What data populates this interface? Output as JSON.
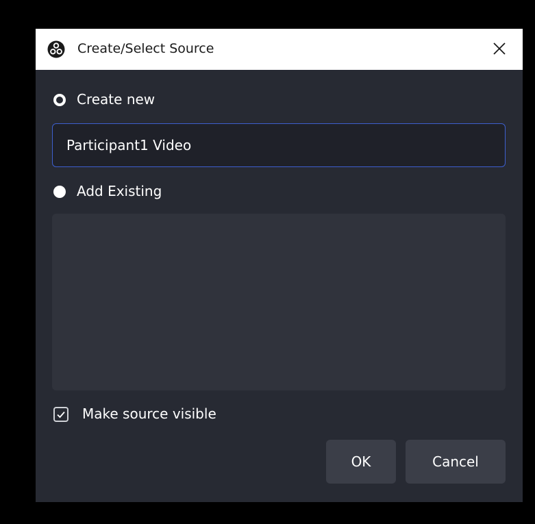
{
  "window": {
    "title": "Create/Select Source",
    "app_icon": "obs-logo-icon",
    "close_icon": "close-icon"
  },
  "options": {
    "create_new_label": "Create new",
    "name_value": "Participant1 Video",
    "add_existing_label": "Add Existing",
    "existing_sources": []
  },
  "visibility": {
    "label": "Make source visible",
    "checked": true
  },
  "buttons": {
    "ok_label": "OK",
    "cancel_label": "Cancel"
  },
  "colors": {
    "dialog_bg": "#272a33",
    "input_bg": "#1f2129",
    "input_focus_border": "#3d5fcf",
    "list_bg": "#30333c",
    "button_bg": "#3b3e48",
    "title_bar_bg": "#ffffff"
  }
}
